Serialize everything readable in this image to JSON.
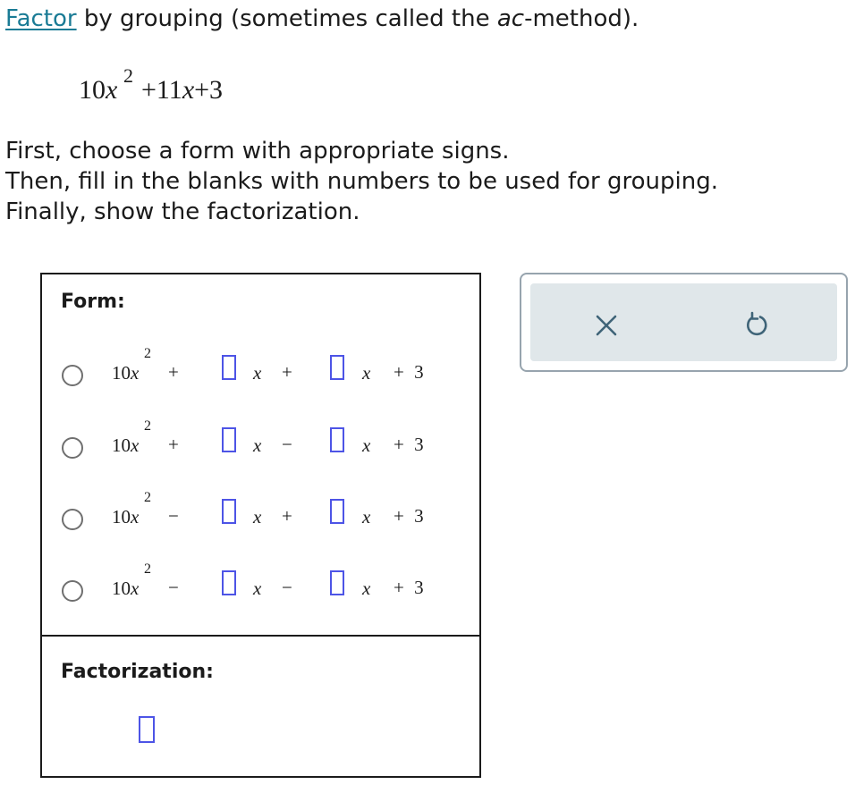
{
  "prompt": {
    "link_text": "Factor",
    "text_before_italic": " by grouping (sometimes called the ",
    "italic_text": "ac",
    "text_after_italic": "-method)."
  },
  "expression": {
    "coef": "10",
    "var": "x",
    "exp": "2",
    "rest": "+11x+3"
  },
  "instructions": [
    "First, choose a form with appropriate signs.",
    "Then, fill in the blanks with numbers to be used for grouping.",
    "Finally, show the factorization."
  ],
  "form_label": "Form:",
  "factorization_label": "Factorization:",
  "lead_term": {
    "coef": "10",
    "var": "x",
    "exp": "2"
  },
  "options": [
    {
      "sign1": "+",
      "sign2": "+",
      "tail": "+ 3"
    },
    {
      "sign1": "+",
      "sign2": "−",
      "tail": "+ 3"
    },
    {
      "sign1": "−",
      "sign2": "+",
      "tail": "+ 3"
    },
    {
      "sign1": "−",
      "sign2": "−",
      "tail": "+ 3"
    }
  ],
  "var_symbol": "x",
  "toolbar": {
    "clear_icon": "x-icon",
    "undo_icon": "undo-icon"
  },
  "colors": {
    "link": "#1a7b95",
    "blank_border": "#4d54e6",
    "toolbar_bg": "#e0e7ea",
    "toolbar_border": "#97a4ae",
    "icon": "#3f6478"
  }
}
